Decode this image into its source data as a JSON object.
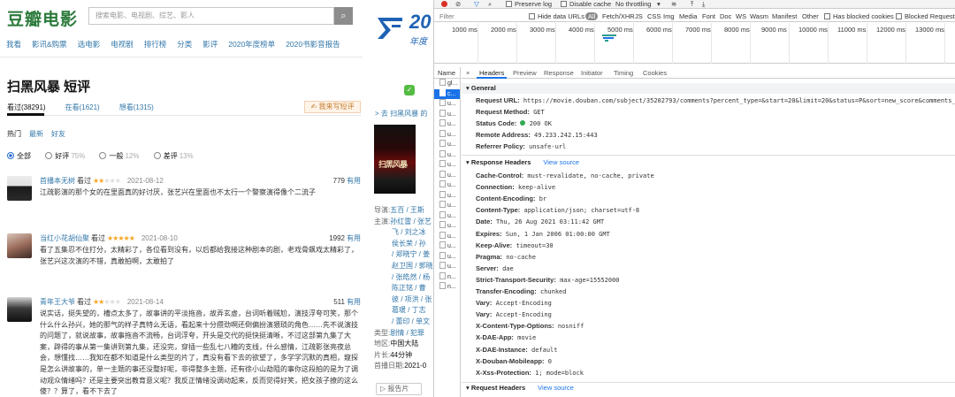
{
  "douban": {
    "logo": "豆瓣电影",
    "search_placeholder": "搜索电影、电视剧、综艺、影人",
    "search_icon": "search-icon",
    "ad": {
      "num": "20",
      "sub": "年度"
    },
    "nav": [
      "我看",
      "影讯&购票",
      "选电影",
      "电视剧",
      "排行榜",
      "分类",
      "影评",
      "2020年度榜单",
      "2020书影音报告"
    ],
    "title": "扫黑风暴 短评",
    "subnav": [
      "看过(38291)",
      "在看(1621)",
      "想看(1315)"
    ],
    "write_button": "✍ 我来写短评",
    "sort": [
      "热门",
      "最新",
      "好友"
    ],
    "filters": [
      {
        "label": "全部",
        "pct": ""
      },
      {
        "label": "好评",
        "pct": "75%"
      },
      {
        "label": "一般",
        "pct": "12%"
      },
      {
        "label": "差评",
        "pct": "13%"
      }
    ],
    "comments": [
      {
        "user": "首播本无树",
        "verb": "看过",
        "stars": "★★",
        "stars_off": "★★★",
        "date": "2021-08-12",
        "useful_count": "779",
        "useful_label": "有用",
        "body": "江疏影演的那个女的在里面真的好讨厌，张艺兴在里面也不太行一个警察演得像个二流子"
      },
      {
        "user": "当红小花胡仙聚",
        "verb": "看过",
        "stars": "★★★★★",
        "stars_off": "",
        "date": "2021-08-10",
        "useful_count": "1992",
        "useful_label": "有用",
        "body": "看了五集忍不住打分，太精彩了，各位看到没有，以后都给我接这种剧本的剧，老戏骨飙戏太精彩了，张艺兴这次演的不错，真敢拍啊，太敢拍了"
      },
      {
        "user": "青年王大爷",
        "verb": "看过",
        "stars": "★★",
        "stars_off": "★★★",
        "date": "2021-08-14",
        "useful_count": "511",
        "useful_label": "有用",
        "body": "说实话，挺失望的，槽点太多了，故事讲的平淡拖沓，故弄玄虚，台词听着贼尬，演技浮夸可笑，那个什么什么孙兴，她的那气的样子真特么无语，看起来十分攒劲啊还倒偏扮演猥琐的角色……先不说演技的问题了，就说故事，故事拖沓不流畅，台词浮夸，开头是交代的挺快挺清晰，不过这部第九集了大案，辟得的事从第一集讲到第九集，还没完，穿插一些乱七八糟的支线，什么感情，江疏影张亮夜总会，想懂找……我知在都不知道是什么类型的片了，真没有看下去的欲望了，多学学沉默的真相，窥探是怎么讲故事的，单一主题的事还没整好呢，非得整多主题，还有徐小山劫阻的事你这段拍的是为了调动观众情绪吗？还是主要突出教育意义呢？我反正情绪没调动起来，反而觉得好笑，把女孩子撩的这么傻？？算了，看不下去了"
      }
    ],
    "right_col": {
      "goto": "> 去 扫黑风暴 的",
      "poster_text": "扫黑风暴",
      "info": [
        {
          "k": "导演:",
          "v": "五百 / 王斯"
        },
        {
          "k": "主演:",
          "v": "孙红雷 / 张艺"
        },
        {
          "k": "",
          "v": "飞 / 刘之冰"
        },
        {
          "k": "",
          "v": "侯长荣 / 孙"
        },
        {
          "k": "",
          "v": "/ 郑晓宁 / 姜"
        },
        {
          "k": "",
          "v": "赵卫国 / 郭晓"
        },
        {
          "k": "",
          "v": "/ 张皓然 / 杨"
        },
        {
          "k": "",
          "v": "陈正铭 / 曹"
        },
        {
          "k": "",
          "v": "彼 / 项洪 / 张"
        },
        {
          "k": "",
          "v": "葛瑗 / 丁志"
        },
        {
          "k": "",
          "v": "/ 蕾印 / 单文"
        },
        {
          "k": "类型:",
          "v": "剧情 / 犯罪"
        },
        {
          "k": "地区:",
          "v": "中国大陆"
        },
        {
          "k": "片长:",
          "v": "44分钟"
        },
        {
          "k": "首播日期:",
          "v": "2021-0"
        }
      ],
      "report": "报告片"
    }
  },
  "devtools": {
    "toolbar": [
      "Preserve log",
      "Disable cache",
      "No throttling",
      "▾"
    ],
    "filter_placeholder": "Filter",
    "filter_types": [
      "Hide data URLs",
      "All",
      "Fetch/XHR",
      "JS",
      "CSS",
      "Img",
      "Media",
      "Font",
      "Doc",
      "WS",
      "Wasm",
      "Manifest",
      "Other",
      "Has blocked cookies",
      "Blocked Requests"
    ],
    "timeline_ticks": [
      "1000 ms",
      "2000 ms",
      "3000 ms",
      "4000 ms",
      "5000 ms",
      "6000 ms",
      "7000 ms",
      "8000 ms",
      "9000 ms",
      "10000 ms",
      "11000 ms",
      "12000 ms",
      "13000 ms"
    ],
    "reqlist_header": "Name",
    "requests": [
      "gl...",
      "c...",
      "u...",
      "u...",
      "u...",
      "u...",
      "u...",
      "u...",
      "u...",
      "u...",
      "u...",
      "u...",
      "u...",
      "u...",
      "u...",
      "u...",
      "u...",
      "u...",
      "u...",
      "n...",
      "n..."
    ],
    "tabs": [
      "×",
      "Headers",
      "Preview",
      "Response",
      "Initiator",
      "Timing",
      "Cookies"
    ],
    "general_title": "General",
    "general": [
      {
        "k": "Request URL:",
        "v": "https://movie.douban.com/subject/35202793/comments?percent_type=&start=20&limit=20&status=P&sort=new_score&comments_only=1&ck=8"
      },
      {
        "k": "Request Method:",
        "v": "GET"
      },
      {
        "k": "Status Code:",
        "v": "200 OK"
      },
      {
        "k": "Remote Address:",
        "v": "49.233.242.15:443"
      },
      {
        "k": "Referrer Policy:",
        "v": "unsafe-url"
      }
    ],
    "response_title": "Response Headers",
    "view_source": "View source",
    "response": [
      {
        "k": "Cache-Control:",
        "v": "must-revalidate, no-cache, private"
      },
      {
        "k": "Connection:",
        "v": "keep-alive"
      },
      {
        "k": "Content-Encoding:",
        "v": "br"
      },
      {
        "k": "Content-Type:",
        "v": "application/json; charset=utf-8"
      },
      {
        "k": "Date:",
        "v": "Thu, 26 Aug 2021 03:11:42 GMT"
      },
      {
        "k": "Expires:",
        "v": "Sun, 1 Jan 2006 01:00:00 GMT"
      },
      {
        "k": "Keep-Alive:",
        "v": "timeout=30"
      },
      {
        "k": "Pragma:",
        "v": "no-cache"
      },
      {
        "k": "Server:",
        "v": "dae"
      },
      {
        "k": "Strict-Transport-Security:",
        "v": "max-age=15552000"
      },
      {
        "k": "Transfer-Encoding:",
        "v": "chunked"
      },
      {
        "k": "Vary:",
        "v": "Accept-Encoding"
      },
      {
        "k": "Vary:",
        "v": "Accept-Encoding"
      },
      {
        "k": "X-Content-Type-Options:",
        "v": "nosniff"
      },
      {
        "k": "X-DAE-App:",
        "v": "movie"
      },
      {
        "k": "X-DAE-Instance:",
        "v": "default"
      },
      {
        "k": "X-Douban-Mobileapp:",
        "v": "0"
      },
      {
        "k": "X-Xss-Protection:",
        "v": "1; mode=block"
      }
    ],
    "request_title": "Request Headers"
  }
}
